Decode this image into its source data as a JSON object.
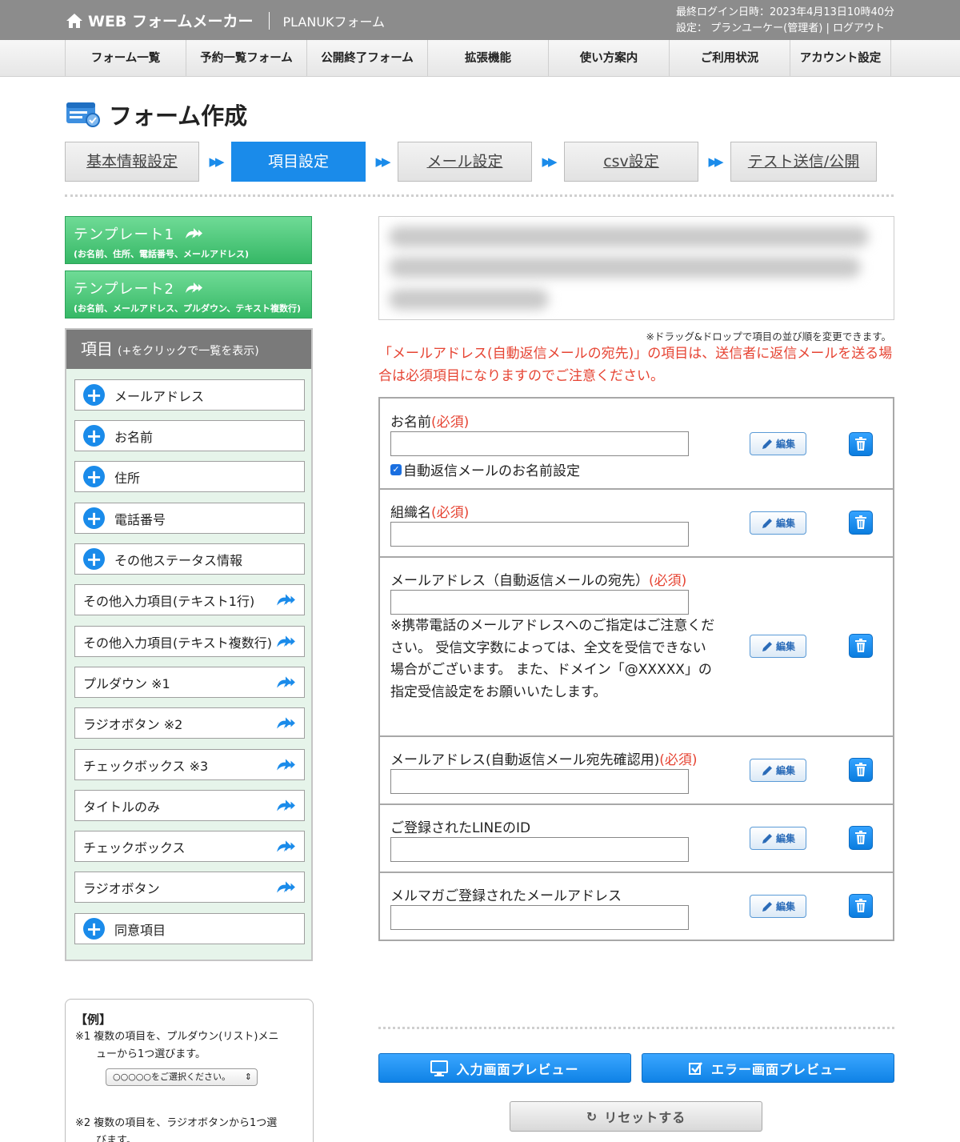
{
  "header": {
    "app_name": "WEB フォームメーカー",
    "sub_name": "PLANUKフォーム",
    "last_login": "最終ログイン日時：2023年4月13日10時40分",
    "settings_label": "設定：",
    "user": "プランユーケー(管理者)",
    "divider": "|",
    "logout": "ログアウト"
  },
  "nav": [
    "フォーム一覧",
    "予約一覧フォーム",
    "公開終了フォーム",
    "拡張機能",
    "使い方案内",
    "ご利用状況",
    "アカウント設定"
  ],
  "page": {
    "title": "フォーム作成"
  },
  "steps": [
    "基本情報設定",
    "項目設定",
    "メール設定",
    "csv設定",
    "テスト送信/公開"
  ],
  "templates": [
    {
      "title": "テンプレート1",
      "desc": "(お名前、住所、電話番号、メールアドレス)"
    },
    {
      "title": "テンプレート2",
      "desc": "(お名前、メールアドレス、プルダウン、テキスト複数行)"
    }
  ],
  "items_panel": {
    "title": "項目",
    "subtitle": "(+をクリックで一覧を表示)",
    "items": [
      "メールアドレス",
      "お名前",
      "住所",
      "電話番号",
      "その他ステータス情報",
      "その他入力項目(テキスト1行)",
      "その他入力項目(テキスト複数行)",
      "プルダウン ※1",
      "ラジオボタン ※2",
      "チェックボックス ※3",
      "タイトルのみ",
      "チェックボックス",
      "ラジオボタン",
      "同意項目"
    ]
  },
  "example": {
    "title": "【例】",
    "line1": "※1 複数の項目を、プルダウン(リスト)メニ",
    "line1b": "ューから1つ選びます。",
    "select_placeholder": "○○○○○をご選択ください。",
    "line2": "※2 複数の項目を、ラジオボタンから1つ選",
    "line2b": "びます。"
  },
  "main": {
    "drag_hint": "※ドラッグ&ドロップで項目の並び順を変更できます。",
    "notice": "「メールアドレス(自動返信メールの宛先)」の項目は、送信者に返信メールを送る場合は必須項目になりますのでご注意ください。",
    "required_mark": "(必須)",
    "edit_label": "編集",
    "fields": [
      {
        "label": "お名前",
        "checkbox": "自動返信メールのお名前設定"
      },
      {
        "label": "組織名"
      },
      {
        "label": "メールアドレス（自動返信メールの宛先）",
        "note": "※携帯電話のメールアドレスへのご指定はご注意ください。 受信文字数によっては、全文を受信できない場合がございます。 また、ドメイン「@XXXXX」の指定受信設定をお願いいたします。"
      },
      {
        "label": "メールアドレス(自動返信メール宛先確認用)"
      },
      {
        "label": "ご登録されたLINEのID"
      },
      {
        "label": "メルマガご登録されたメールアドレス"
      }
    ]
  },
  "buttons": {
    "input_preview": "入力画面プレビュー",
    "error_preview": "エラー画面プレビュー",
    "reset": "リセットする"
  },
  "colors": {
    "accent": "#1a8bea",
    "required": "#e64433",
    "template": "#36b866",
    "header": "#8c8c8c"
  }
}
